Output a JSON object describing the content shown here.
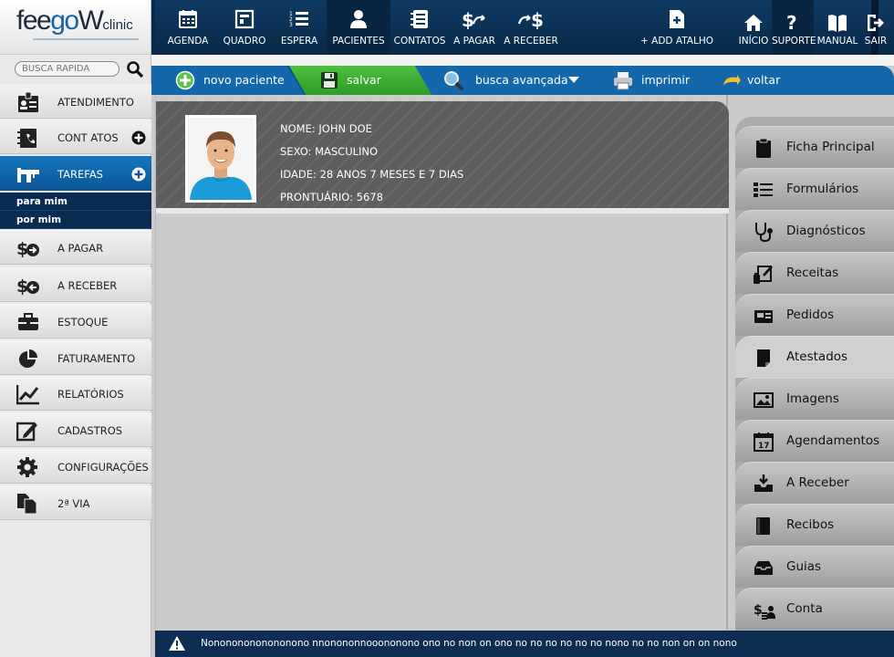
{
  "brand": {
    "part1": "fee",
    "part2": "go",
    "part3": "W",
    "part4": "clinic"
  },
  "search": {
    "placeholder": "BUSCA RÁPIDA"
  },
  "sidebar": {
    "items": [
      {
        "label": "ATENDIMENTO",
        "icon": "id-card-icon"
      },
      {
        "label": "CONT  ATOS",
        "icon": "address-book-icon"
      },
      {
        "label": "TAREFAS",
        "icon": "tasks-icon",
        "active": true
      },
      {
        "label": "A PAGAR",
        "icon": "dollar-out-icon"
      },
      {
        "label": "A RECEBER",
        "icon": "dollar-in-icon"
      },
      {
        "label": "ESTOQUE",
        "icon": "briefcase-icon"
      },
      {
        "label": "FATURAMENTO",
        "icon": "pie-chart-icon"
      },
      {
        "label": "RELATÓRIOS",
        "icon": "line-chart-icon"
      },
      {
        "label": "CADASTROS",
        "icon": "edit-icon"
      },
      {
        "label": "CONFIGURAÇÕES",
        "icon": "gear-icon"
      },
      {
        "label": "2ª VIA",
        "icon": "copy-icon"
      }
    ],
    "sub_items": [
      "para mim",
      "por mim"
    ]
  },
  "topnav": {
    "items": [
      {
        "label": "AGENDA",
        "icon": "calendar-icon"
      },
      {
        "label": "QUADRO",
        "icon": "board-icon"
      },
      {
        "label": "ESPERA",
        "icon": "list-ordered-icon"
      },
      {
        "label": "PACIENTES",
        "icon": "user-icon",
        "active": true
      },
      {
        "label": "CONTATOS",
        "icon": "contacts-icon"
      },
      {
        "label": "A PAGAR",
        "icon": "dollar-out-icon"
      },
      {
        "label": "A RECEBER",
        "icon": "dollar-in-icon"
      },
      {
        "label": "+ ADD ATALHO",
        "icon": "add-file-icon"
      },
      {
        "label": "INÍCIO",
        "icon": "home-icon"
      },
      {
        "label": "SUPORTE",
        "icon": "question-icon"
      },
      {
        "label": "MANUAL",
        "icon": "book-icon"
      },
      {
        "label": "SAIR",
        "icon": "logout-icon"
      }
    ]
  },
  "toolbar": {
    "novo": "novo paciente",
    "salvar": "salvar",
    "busca": "busca avançada",
    "imprimir": "imprimir",
    "voltar": "voltar"
  },
  "patient": {
    "nome": "NOME: JOHN DOE",
    "sexo": "SEXO: MASCULINO",
    "idade": "IDADE: 28 ANOS 7 MESES E 7 DIAS",
    "prontuario": "PRONTUÁRIO: 5678"
  },
  "right_tabs": [
    {
      "label": "Ficha Principal",
      "icon": "clipboard-icon"
    },
    {
      "label": "Formulários",
      "icon": "list-icon"
    },
    {
      "label": "Diagnósticos",
      "icon": "stethoscope-icon"
    },
    {
      "label": "Receitas",
      "icon": "prescription-icon"
    },
    {
      "label": "Pedidos",
      "icon": "order-card-icon"
    },
    {
      "label": "Atestados",
      "icon": "document-icon",
      "active": true
    },
    {
      "label": "Imagens",
      "icon": "image-icon"
    },
    {
      "label": "Agendamentos",
      "icon": "calendar-17-icon"
    },
    {
      "label": "A Receber",
      "icon": "tray-in-icon"
    },
    {
      "label": "Recibos",
      "icon": "receipt-book-icon"
    },
    {
      "label": "Guias",
      "icon": "inbox-icon"
    },
    {
      "label": "Conta",
      "icon": "account-icon"
    }
  ],
  "status": {
    "text": "Nonononononononono nnonononnooononono ono no non on ono no no no no no no nono no no non on on  nono"
  },
  "colors": {
    "primary": "#1467ab",
    "dark_nav": "#0f3a63",
    "save_green": "#3aad31",
    "status_bar": "#0d2e52"
  }
}
